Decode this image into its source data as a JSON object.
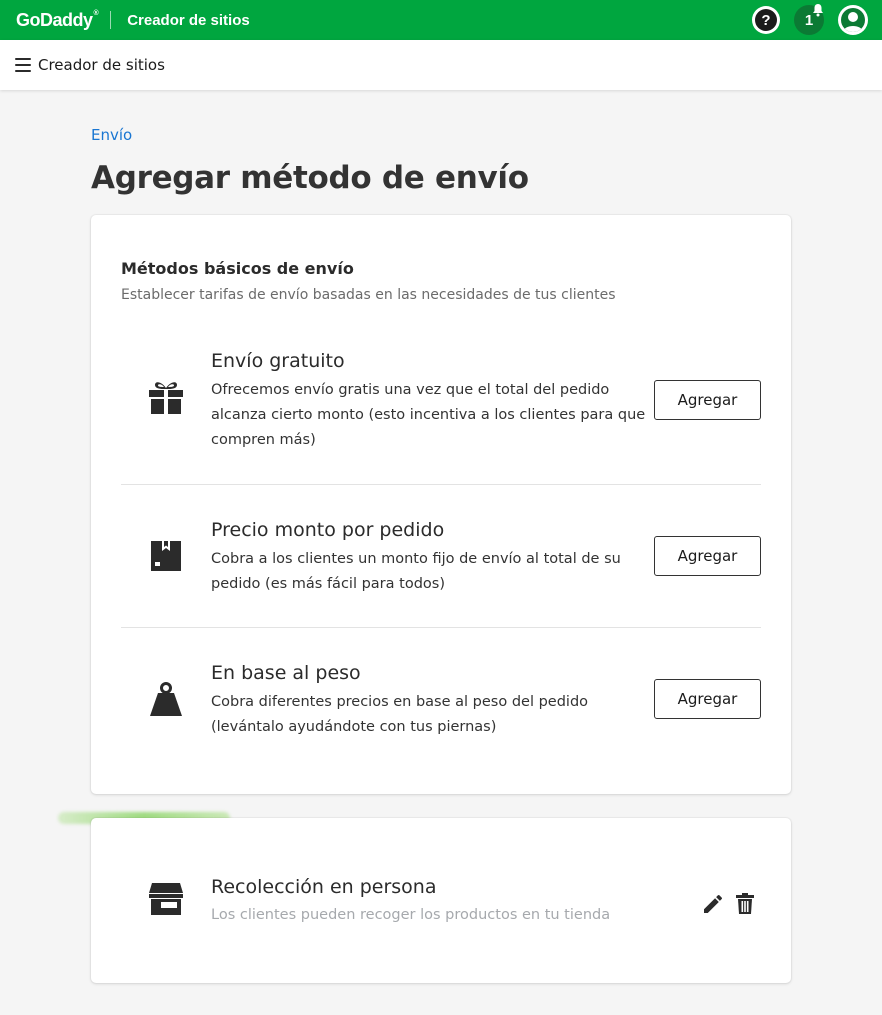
{
  "topbar": {
    "logo": "GoDaddy",
    "logo_mark": "®",
    "product": "Creador de sitios",
    "help_label": "?",
    "notification_count": "1",
    "accent_color": "#00a63f"
  },
  "subbar": {
    "title": "Creador de sitios"
  },
  "breadcrumb": "Envío",
  "page_title": "Agregar método de envío",
  "basic": {
    "title": "Métodos básicos de envío",
    "subtitle": "Establecer tarifas de envío basadas en las necesidades de tus clientes",
    "methods": [
      {
        "icon": "gift-icon",
        "title": "Envío gratuito",
        "description": "Ofrecemos envío gratis una vez que el total del pedido alcanza cierto monto (esto incentiva a los clientes para que compren más)",
        "button": "Agregar"
      },
      {
        "icon": "box-icon",
        "title": "Precio monto por pedido",
        "description": "Cobra a los clientes un monto fijo de envío al total de su pedido (es más fácil para todos)",
        "button": "Agregar"
      },
      {
        "icon": "weight-icon",
        "title": "En base al peso",
        "description": "Cobra diferentes precios en base al peso del pedido (levántalo ayudándote con tus piernas)",
        "button": "Agregar"
      }
    ]
  },
  "pickup": {
    "icon": "store-icon",
    "title": "Recolección en persona",
    "description": "Los clientes pueden recoger los productos en tu tienda"
  }
}
